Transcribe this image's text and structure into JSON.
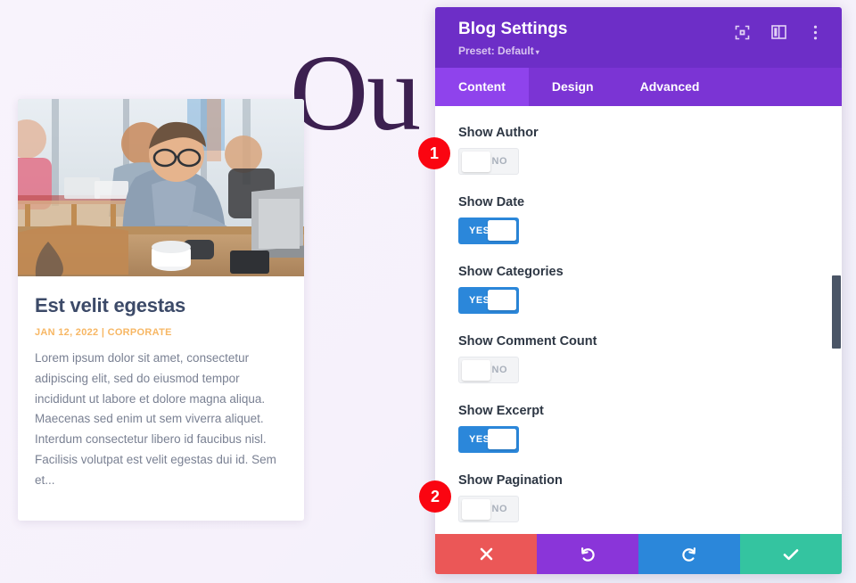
{
  "hero": {
    "word": "Ou"
  },
  "blog_card": {
    "image_alt": "man-with-glasses-working-on-laptop-in-cafe",
    "title": "Est velit egestas",
    "meta": "JAN 12, 2022 | CORPORATE",
    "excerpt": "Lorem ipsum dolor sit amet, consectetur adipiscing elit, sed do eiusmod tempor incididunt ut labore et dolore magna aliqua. Maecenas sed enim ut sem viverra aliquet. Interdum consectetur libero id faucibus nisl. Facilisis volutpat est velit egestas dui id. Sem et...",
    "meta_color": "#f7b764",
    "title_color": "#3c4a68"
  },
  "panel": {
    "title": "Blog Settings",
    "preset": "Preset: Default",
    "preset_caret": "▾",
    "header_color": "#6d2ec7",
    "icons": [
      {
        "name": "focus-icon"
      },
      {
        "name": "layout-panel-icon"
      },
      {
        "name": "more-options-icon"
      }
    ],
    "tabs": [
      {
        "label": "Content",
        "active": true
      },
      {
        "label": "Design",
        "active": false
      },
      {
        "label": "Advanced",
        "active": false
      }
    ],
    "fields": [
      {
        "label": "Show Author",
        "value": "NO",
        "on": false
      },
      {
        "label": "Show Date",
        "value": "YES",
        "on": true
      },
      {
        "label": "Show Categories",
        "value": "YES",
        "on": true
      },
      {
        "label": "Show Comment Count",
        "value": "NO",
        "on": false
      },
      {
        "label": "Show Excerpt",
        "value": "YES",
        "on": true
      },
      {
        "label": "Show Pagination",
        "value": "NO",
        "on": false
      }
    ],
    "footer": [
      {
        "name": "cancel-button",
        "icon": "close-icon",
        "color": "#eb5757"
      },
      {
        "name": "undo-button",
        "icon": "undo-icon",
        "color": "#8a35d9"
      },
      {
        "name": "redo-button",
        "icon": "redo-icon",
        "color": "#2b87da"
      },
      {
        "name": "save-button",
        "icon": "check-icon",
        "color": "#34c4a0"
      }
    ]
  },
  "markers": [
    {
      "label": "1"
    },
    {
      "label": "2"
    }
  ]
}
